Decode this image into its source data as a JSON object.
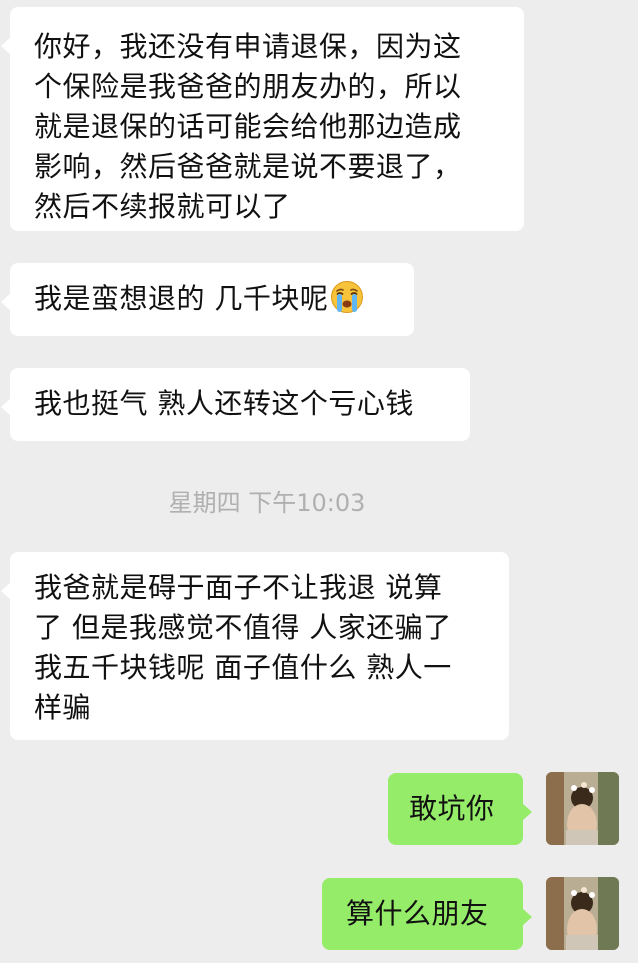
{
  "messages": [
    {
      "side": "left",
      "lines": [
        "你好，我还没有申请退保，因为这",
        "个保险是我爸爸的朋友办的，所以",
        "就是退保的话可能会给他那边造成",
        "影响，然后爸爸就是说不要退了，",
        "然后不续报就可以了"
      ]
    },
    {
      "side": "left",
      "lines": [
        "我是蛮想退的 几千块呢"
      ],
      "emoji": "crying-face"
    },
    {
      "side": "left",
      "lines": [
        "我也挺气 熟人还转这个亏心钱"
      ]
    },
    {
      "side": "left",
      "lines": [
        "我爸就是碍于面子不让我退 说算",
        "了 但是我感觉不值得 人家还骗了",
        "我五千块钱呢 面子值什么 熟人一",
        "样骗"
      ]
    },
    {
      "side": "right",
      "lines": [
        "敢坑你"
      ]
    },
    {
      "side": "right",
      "lines": [
        "算什么朋友"
      ]
    }
  ],
  "timestamp": "星期四 下午10:03",
  "colors": {
    "background": "#ededed",
    "incoming_bubble": "#ffffff",
    "outgoing_bubble": "#95ec69",
    "timestamp_text": "#b0b0b0"
  },
  "icons": {
    "emoji": "crying-face-emoji",
    "avatar": "user-avatar-photo"
  }
}
